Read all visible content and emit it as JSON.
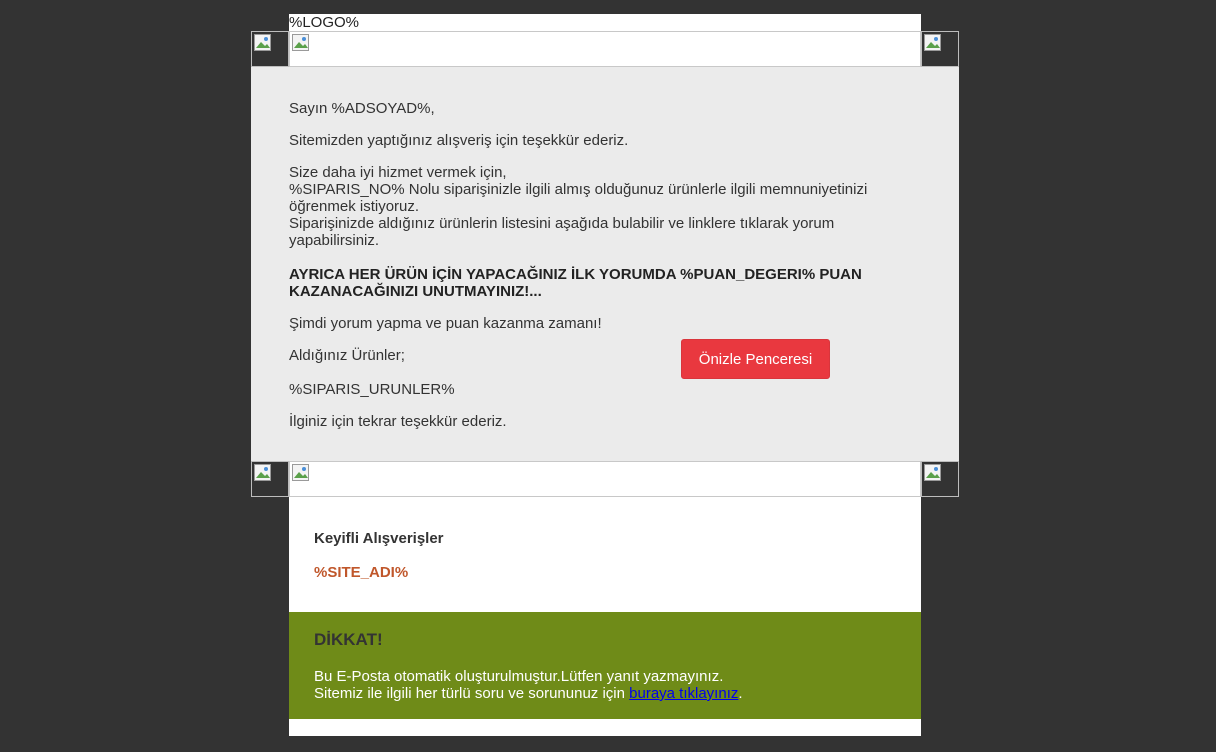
{
  "header": {
    "logo_placeholder": "%LOGO%"
  },
  "message": {
    "greeting": "Sayın %ADSOYAD%,",
    "thanks": "Sitemizden yaptığınız alışveriş için teşekkür ederiz.",
    "intro_line1": "Size daha iyi hizmet vermek için,",
    "intro_line2": "%SIPARIS_NO% Nolu siparişinizle ilgili almış olduğunuz ürünlerle ilgili memnuniyetinizi",
    "intro_line3": "öğrenmek istiyoruz.",
    "intro_line4": "Siparişinizde aldığınız ürünlerin listesini aşağıda bulabilir ve linklere tıklarak yorum",
    "intro_line5": "yapabilirsiniz.",
    "bold_line1": "AYRICA HER ÜRÜN İÇİN YAPACAĞINIZ İLK YORUMDA %PUAN_DEGERI% PUAN",
    "bold_line2": "KAZANACAĞINIZI UNUTMAYINIZ!...",
    "now_text": "Şimdi yorum yapma ve puan kazanma zamanı!",
    "products_label": "Aldığınız Ürünler;",
    "products_placeholder": "%SIPARIS_URUNLER%",
    "closing": "İlginiz için tekrar teşekkür ederiz."
  },
  "preview_button": {
    "label": "Önizle Penceresi",
    "color": "#e9383f"
  },
  "signature": {
    "title": "Keyifli Alışverişler",
    "site_name": "%SITE_ADI%",
    "site_name_color": "#c0572b"
  },
  "warning": {
    "title": "DİKKAT!",
    "line1": "Bu E-Posta otomatik oluşturulmuştur.Lütfen yanıt yazmayınız.",
    "line2_prefix": "Sitemiz ile ilgili her türlü soru ve sorununuz için ",
    "link_text": "buraya tıklayınız",
    "line2_suffix": ".",
    "background": "#6f8b18"
  },
  "icons": {
    "broken_image": "broken-image-icon"
  }
}
